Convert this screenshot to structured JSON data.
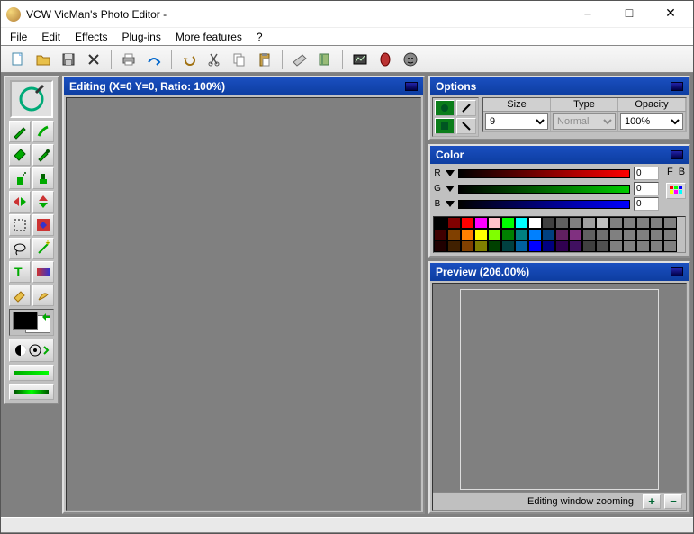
{
  "window": {
    "title": "VCW VicMan's Photo Editor -"
  },
  "menu": {
    "file": "File",
    "edit": "Edit",
    "effects": "Effects",
    "plugins": "Plug-ins",
    "more": "More features",
    "help": "?"
  },
  "toolbar": {
    "icons": [
      "new",
      "open",
      "save",
      "delete",
      "print",
      "export",
      "undo",
      "cut",
      "copy",
      "paste",
      "acquire",
      "book",
      "fx",
      "record",
      "face"
    ]
  },
  "editing": {
    "title": "Editing (X=0 Y=0, Ratio: 100%)"
  },
  "options": {
    "title": "Options",
    "headers": {
      "size": "Size",
      "type": "Type",
      "opacity": "Opacity"
    },
    "size": "9",
    "type": "Normal",
    "opacity": "100%"
  },
  "color": {
    "title": "Color",
    "r_label": "R",
    "g_label": "G",
    "b_label": "B",
    "r": "0",
    "g": "0",
    "b": "0",
    "f_label": "F",
    "b_label2": "B",
    "palette": [
      "#000000",
      "#800000",
      "#ff0000",
      "#ff00ff",
      "#ffc0cb",
      "#00ff00",
      "#00ffff",
      "#ffffff",
      "#404040",
      "#606060",
      "#808080",
      "#a0a0a0",
      "#c0c0c0",
      "#808080",
      "#808080",
      "#808080",
      "#808080",
      "#808080",
      "#400000",
      "#804000",
      "#ff8000",
      "#ffff00",
      "#80ff00",
      "#008000",
      "#008080",
      "#0080ff",
      "#004080",
      "#602060",
      "#803080",
      "#606060",
      "#707070",
      "#808080",
      "#808080",
      "#808080",
      "#808080",
      "#808080",
      "#200000",
      "#402000",
      "#804000",
      "#808000",
      "#004000",
      "#004040",
      "#0060a0",
      "#0000ff",
      "#000080",
      "#300050",
      "#401060",
      "#404040",
      "#505050",
      "#808080",
      "#808080",
      "#808080",
      "#808080",
      "#808080"
    ]
  },
  "preview": {
    "title": "Preview (206.00%)",
    "foot": "Editing window zooming"
  }
}
